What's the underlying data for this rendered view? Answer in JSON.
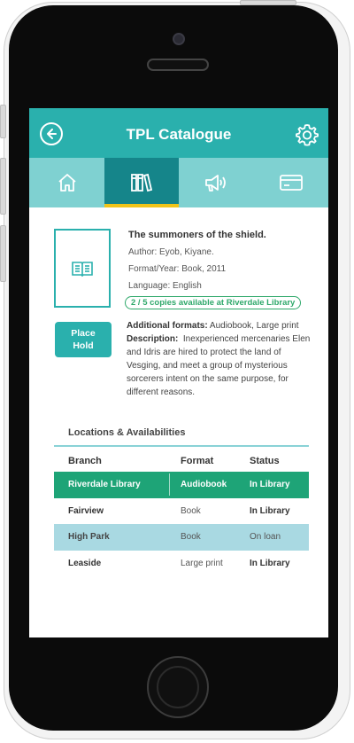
{
  "app": {
    "title": "TPL Catalogue"
  },
  "nav": {
    "tabs": [
      {
        "icon": "home-icon",
        "active": false
      },
      {
        "icon": "books-icon",
        "active": true
      },
      {
        "icon": "megaphone-icon",
        "active": false
      },
      {
        "icon": "card-icon",
        "active": false
      }
    ]
  },
  "book": {
    "title": "The summoners of the shield.",
    "author": "Author: Eyob, Kiyane.",
    "format_year": "Format/Year: Book, 2011",
    "language": "Language: English",
    "availability": "2 / 5 copies available at Riverdale Library",
    "place_hold_label": "Place Hold",
    "additional_formats_label": "Additional formats:",
    "additional_formats_value": "Audiobook, Large print",
    "description_label": "Description:",
    "description_value": "Inexperienced mercenaries Elen and Idris are hired to protect the land of Vesging, and meet a group of mysterious sorcerers intent on the same purpose, for different reasons."
  },
  "locations": {
    "heading": "Locations & Availabilities",
    "columns": [
      "Branch",
      "Format",
      "Status"
    ],
    "rows": [
      {
        "branch": "Riverdale Library",
        "format": "Audiobook",
        "status": "In Library",
        "selected": true
      },
      {
        "branch": "Fairview",
        "format": "Book",
        "status": "In Library"
      },
      {
        "branch": "High Park",
        "format": "Book",
        "status": "On loan"
      },
      {
        "branch": "Leaside",
        "format": "Large print",
        "status": "In Library"
      }
    ]
  },
  "colors": {
    "header": "#2ab0ad",
    "nav": "#7fd1d1",
    "nav_active": "#15858a",
    "tab_indicator": "#f0c419",
    "available_green": "#2ea86a",
    "selected_row": "#1ea477",
    "alt_row": "#a9d9e2"
  }
}
